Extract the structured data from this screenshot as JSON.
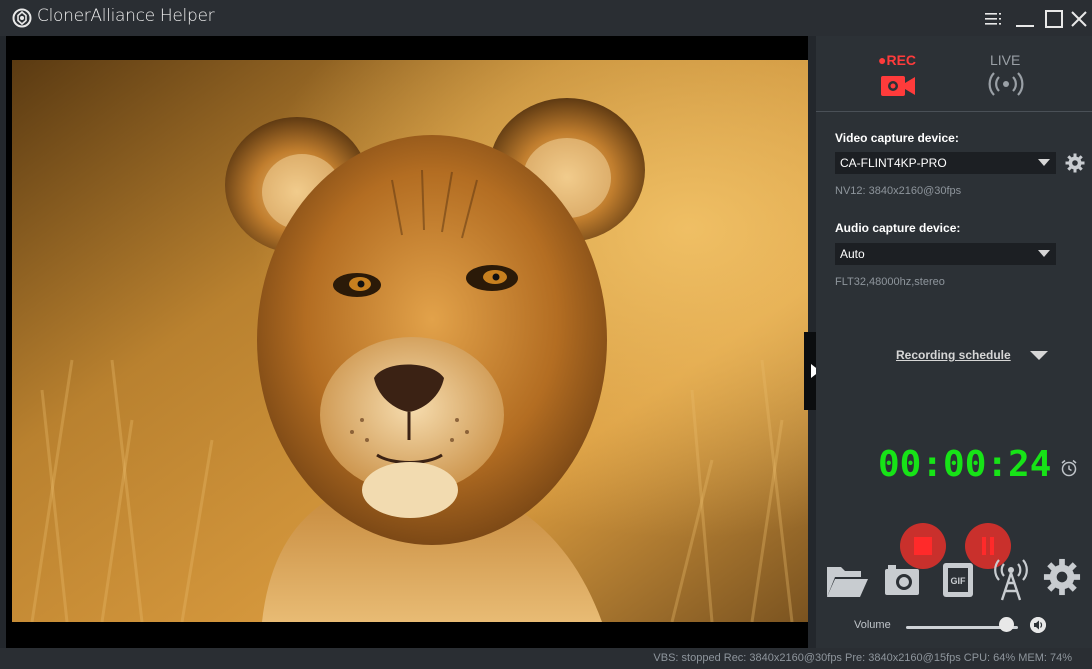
{
  "window": {
    "title": "ClonerAlliance Helper"
  },
  "modes": {
    "rec_label": "●REC",
    "live_label": "LIVE"
  },
  "video_capture": {
    "label": "Video capture device:",
    "selected": "CA-FLINT4KP-PRO",
    "format": "NV12: 3840x2160@30fps"
  },
  "audio_capture": {
    "label": "Audio capture device:",
    "selected": "Auto",
    "format": "FLT32,48000hz,stereo"
  },
  "schedule": {
    "label": "Recording schedule"
  },
  "recording": {
    "elapsed": "00:00:24"
  },
  "volume": {
    "label": "Volume",
    "level": 0.9
  },
  "status": {
    "text": "VBS: stopped   Rec: 3840x2160@30fps  Pre: 3840x2160@15fps  CPU: 64%  MEM: 74%"
  },
  "colors": {
    "rec_accent": "#ff3b3b",
    "timer": "#17e317",
    "stop_pause": "#c9302c"
  },
  "icons": {
    "title": "logo-icon",
    "menu": "menu-icon",
    "minimize": "minimize-icon",
    "maximize": "maximize-icon",
    "close": "close-icon",
    "rec": "camcorder-icon",
    "live": "broadcast-icon",
    "settings": "gear-icon",
    "alarm": "alarm-clock-icon",
    "folder": "folder-icon",
    "snapshot": "camera-icon",
    "gif": "gif-icon",
    "antenna": "antenna-icon"
  }
}
